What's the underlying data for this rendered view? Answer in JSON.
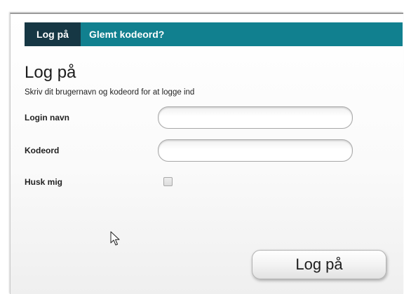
{
  "tabs": {
    "login_label": "Log på",
    "forgot_label": "Glemt kodeord?"
  },
  "form": {
    "title": "Log på",
    "subtitle": "Skriv dit brugernavn og kodeord for at logge ind",
    "username_label": "Login navn",
    "username_value": "",
    "password_label": "Kodeord",
    "password_value": "",
    "remember_label": "Husk mig",
    "remember_checked": false,
    "submit_label": "Log på"
  },
  "colors": {
    "tab_bar": "#11808f",
    "tab_active": "#163744"
  },
  "icons": {
    "cursor": "mouse-pointer-icon"
  }
}
